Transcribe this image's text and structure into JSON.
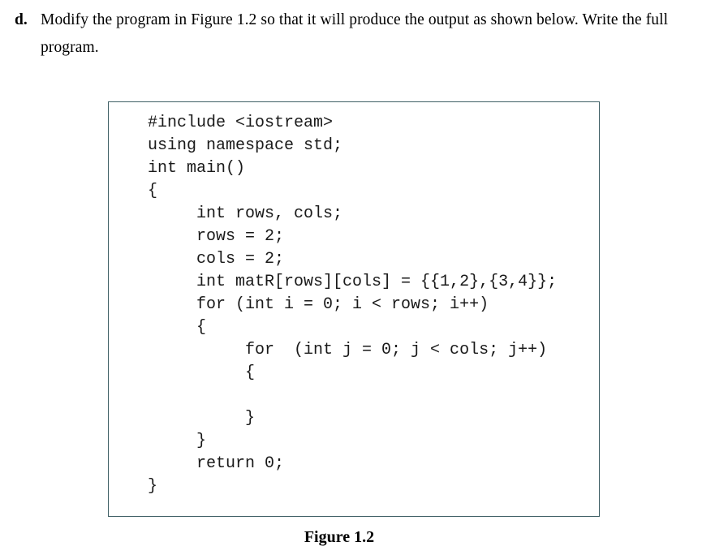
{
  "question": {
    "marker": "d.",
    "text": "Modify the program in Figure 1.2 so that it will produce the output as shown below. Write the full program."
  },
  "figure": {
    "caption": "Figure 1.2",
    "border_color": "#3f5f65",
    "code_lines": [
      "#include <iostream>",
      "using namespace std;",
      "int main()",
      "{",
      "     int rows, cols;",
      "     rows = 2;",
      "     cols = 2;",
      "     int matR[rows][cols] = {{1,2},{3,4}};",
      "     for (int i = 0; i < rows; i++)",
      "     {",
      "          for  (int j = 0; j < cols; j++)",
      "          {",
      "",
      "          }",
      "     }",
      "     return 0;",
      "}"
    ]
  }
}
